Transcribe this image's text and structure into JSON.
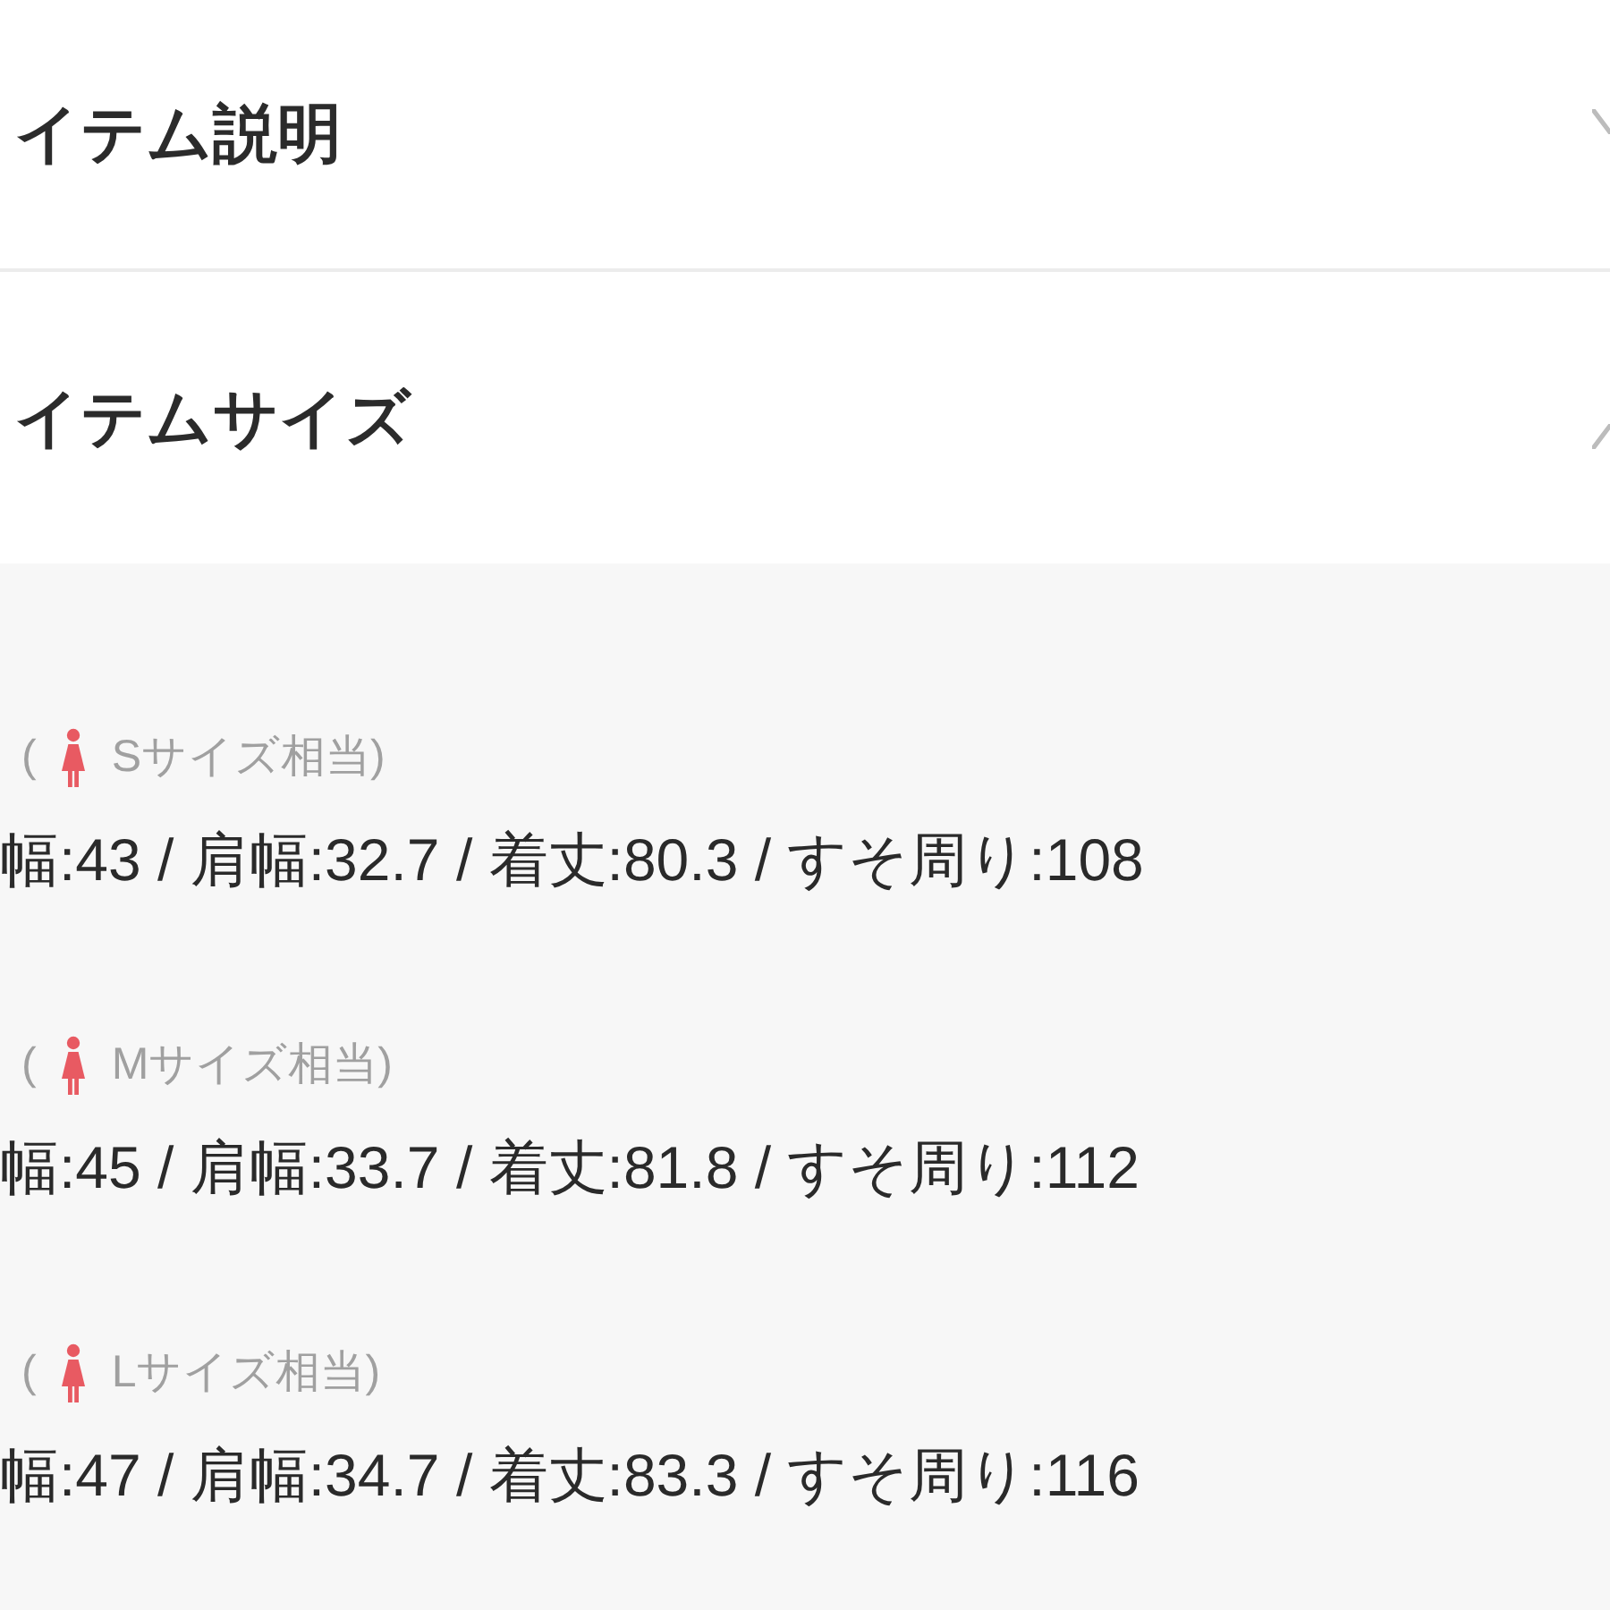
{
  "sections": [
    {
      "title": "イテム説明",
      "expanded": false
    },
    {
      "title": "イテムサイズ",
      "expanded": true,
      "sizes": [
        {
          "open_paren": "(",
          "label": "Sサイズ相当)",
          "measurements": "幅:43 / 肩幅:32.7 / 着丈:80.3 / すそ周り:108"
        },
        {
          "open_paren": "(",
          "label": "Mサイズ相当)",
          "measurements": "幅:45 / 肩幅:33.7 / 着丈:81.8 / すそ周り:112"
        },
        {
          "open_paren": "(",
          "label": "Lサイズ相当)",
          "measurements": "幅:47 / 肩幅:34.7 / 着丈:83.3 / すそ周り:116"
        }
      ]
    }
  ]
}
